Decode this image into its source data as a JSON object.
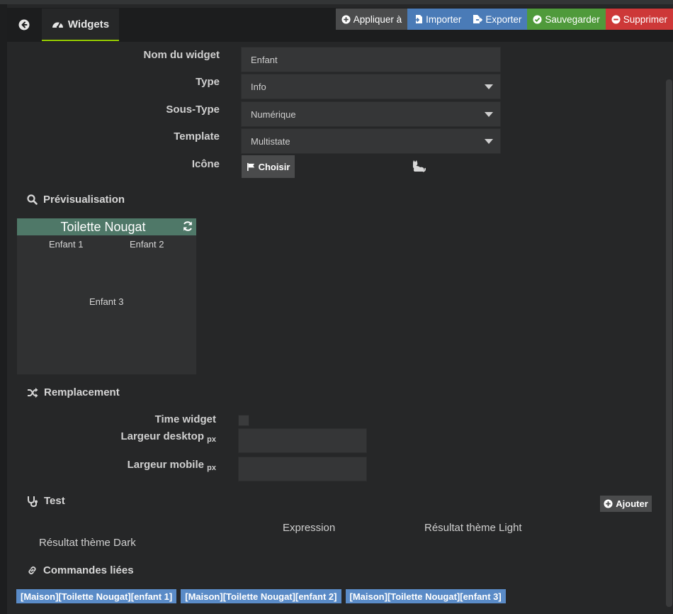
{
  "tabs": {
    "active_label": "Widgets"
  },
  "actions": {
    "apply": "Appliquer à",
    "import": "Importer",
    "export": "Exporter",
    "save": "Sauvegarder",
    "delete": "Supprimer"
  },
  "form": {
    "name_label": "Nom du widget",
    "name_value": "Enfant",
    "type_label": "Type",
    "type_value": "Info",
    "subtype_label": "Sous-Type",
    "subtype_value": "Numérique",
    "template_label": "Template",
    "template_value": "Multistate",
    "icon_label": "Icône",
    "choose_label": "Choisir"
  },
  "preview": {
    "section_title": "Prévisualisation",
    "widget_title": "Toilette Nougat",
    "children": [
      "Enfant 1",
      "Enfant 2",
      "Enfant 3"
    ]
  },
  "replacement": {
    "section_title": "Remplacement",
    "time_widget_label": "Time widget",
    "desktop_width_label": "Largeur desktop",
    "mobile_width_label": "Largeur mobile",
    "unit": "px"
  },
  "test": {
    "section_title": "Test",
    "add_label": "Ajouter",
    "columns": [
      "Résultat thème Dark",
      "Expression",
      "Résultat thème Light"
    ]
  },
  "linked": {
    "section_title": "Commandes liées",
    "commands": [
      "[Maison][Toilette Nougat][enfant 1]",
      "[Maison][Toilette Nougat][enfant 2]",
      "[Maison][Toilette Nougat][enfant 3]"
    ]
  }
}
